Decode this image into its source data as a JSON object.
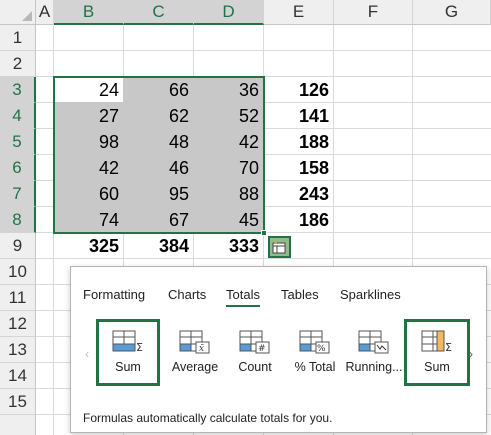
{
  "columns": [
    "A",
    "B",
    "C",
    "D",
    "E",
    "F",
    "G"
  ],
  "rows": [
    "1",
    "2",
    "3",
    "4",
    "5",
    "6",
    "7",
    "8",
    "9",
    "10",
    "11",
    "12",
    "13",
    "14",
    "15"
  ],
  "data_rows": [
    {
      "b": "24",
      "c": "66",
      "d": "36",
      "e": "126"
    },
    {
      "b": "27",
      "c": "62",
      "d": "52",
      "e": "141"
    },
    {
      "b": "98",
      "c": "48",
      "d": "42",
      "e": "188"
    },
    {
      "b": "42",
      "c": "46",
      "d": "70",
      "e": "158"
    },
    {
      "b": "60",
      "c": "95",
      "d": "88",
      "e": "243"
    },
    {
      "b": "74",
      "c": "67",
      "d": "45",
      "e": "186"
    }
  ],
  "totals_row": {
    "b": "325",
    "c": "384",
    "d": "333"
  },
  "quick_analysis": {
    "tabs": [
      "Formatting",
      "Charts",
      "Totals",
      "Tables",
      "Sparklines"
    ],
    "active_tab": "Totals",
    "tiles": [
      {
        "label": "Sum",
        "icon": "sum-row-icon"
      },
      {
        "label": "Average",
        "icon": "average-icon"
      },
      {
        "label": "Count",
        "icon": "count-icon"
      },
      {
        "label": "% Total",
        "icon": "percent-total-icon"
      },
      {
        "label": "Running...",
        "icon": "running-total-icon"
      },
      {
        "label": "Sum",
        "icon": "sum-column-icon"
      }
    ],
    "description": "Formulas automatically calculate totals for you."
  },
  "colors": {
    "accent": "#217346",
    "selection": "#c8c8c8",
    "icon_blue": "#5b9bd5",
    "icon_orange": "#f4b860"
  }
}
